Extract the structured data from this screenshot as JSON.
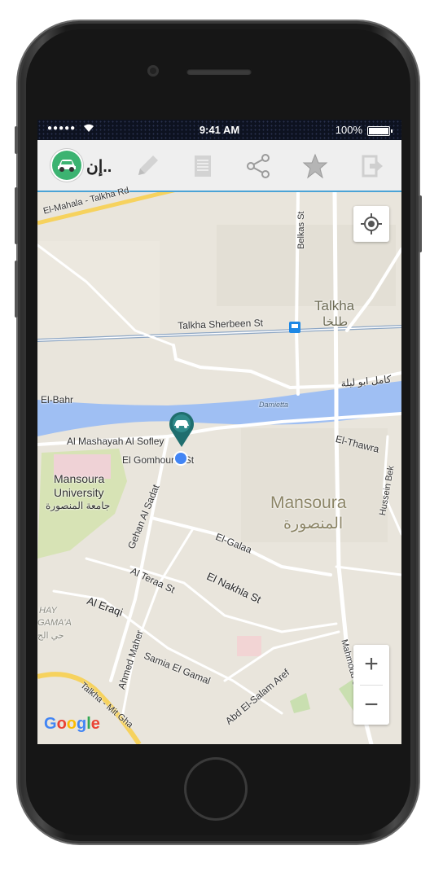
{
  "status_bar": {
    "signal": "●●●●●",
    "time": "9:41 AM",
    "battery": "100%"
  },
  "toolbar": {
    "title": "إن..",
    "icons": [
      "car-logo-icon",
      "pencil-icon",
      "document-icon",
      "share-icon",
      "star-icon",
      "logout-icon"
    ]
  },
  "map": {
    "labels": {
      "mahala_rd": "El-Mahala - Talkha Rd",
      "belkas": "Belkas St",
      "talkha_en": "Talkha",
      "talkha_ar": "طلخا",
      "sherbeen": "Talkha Sherbeen St",
      "kamel": "كامل ابو ليلة",
      "el_bahr": "El-Bahr",
      "damietta": "Damietta",
      "mashayah": "Al Mashayah Al Sofley",
      "gomhouria": "El Gomhouria St",
      "thawra": "El-Thawra",
      "hussein": "Hussein Bek",
      "univ_en1": "Mansoura",
      "univ_en2": "University",
      "univ_ar": "جامعة المنصورة",
      "gehan": "Gehan Al Sadat",
      "mansoura_en": "Mansoura",
      "mansoura_ar": "المنصورة",
      "galaa": "El-Galaa",
      "teraa": "Al Teraa St",
      "nakhla": "El Nakhla St",
      "eraqi": "Al Eraqi",
      "hay": "HAY",
      "gamaa": "GAMA'A",
      "hay_ar": "حي الج",
      "ahmed": "Ahmed Maher",
      "samia": "Samia El Gamal",
      "abd": "Abd El-Salam Aref",
      "mahmoud": "Mahmoud Shaheen",
      "talkha_mit": "Talkha - Mit Gha"
    },
    "zoom_in": "+",
    "zoom_out": "−",
    "attribution": "Google"
  }
}
